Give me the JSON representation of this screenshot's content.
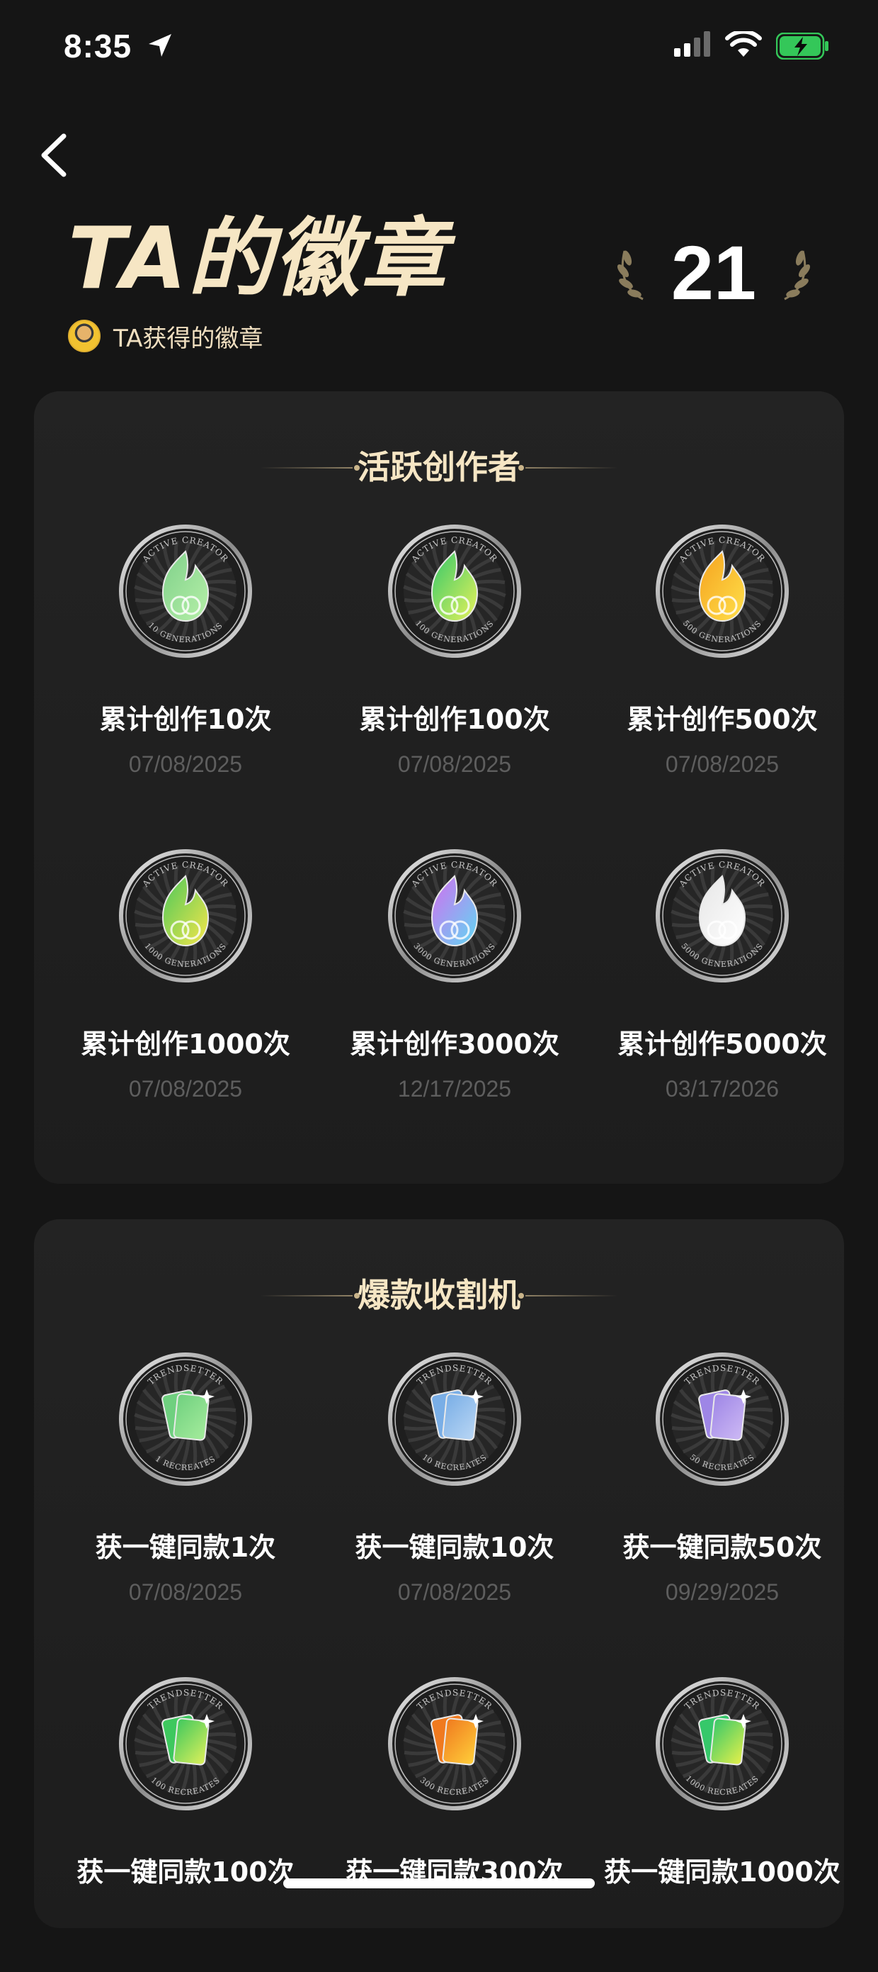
{
  "status_bar": {
    "time": "8:35"
  },
  "header": {
    "title": "TA的徽章",
    "subtitle": "TA获得的徽章",
    "badge_count": "21"
  },
  "sections": [
    {
      "title": "活跃创作者",
      "badges": [
        {
          "name": "累计创作10次",
          "date": "07/08/2025",
          "ring_top": "ACTIVE CREATOR",
          "ring_bottom": "10 GENERATIONS",
          "number": "10",
          "colors": [
            "#7fd08a",
            "#b6f0a8"
          ]
        },
        {
          "name": "累计创作100次",
          "date": "07/08/2025",
          "ring_top": "ACTIVE CREATOR",
          "ring_bottom": "100 GENERATIONS",
          "number": "100",
          "colors": [
            "#35c86a",
            "#e7f25a"
          ]
        },
        {
          "name": "累计创作500次",
          "date": "07/08/2025",
          "ring_top": "ACTIVE CREATOR",
          "ring_bottom": "500 GENERATIONS",
          "number": "500",
          "colors": [
            "#f5a21f",
            "#ffe04a"
          ]
        },
        {
          "name": "累计创作1000次",
          "date": "07/08/2025",
          "ring_top": "ACTIVE CREATOR",
          "ring_bottom": "1000 GENERATIONS",
          "number": "1000",
          "colors": [
            "#4cc85a",
            "#f6e64a"
          ]
        },
        {
          "name": "累计创作3000次",
          "date": "12/17/2025",
          "ring_top": "ACTIVE CREATOR",
          "ring_bottom": "3000 GENERATIONS",
          "number": "3000",
          "colors": [
            "#d36ef0",
            "#5fd8f2"
          ]
        },
        {
          "name": "累计创作5000次",
          "date": "03/17/2026",
          "ring_top": "ACTIVE CREATOR",
          "ring_bottom": "5000 GENERATIONS",
          "number": "5000",
          "colors": [
            "#e6e6e6",
            "#ffffff"
          ]
        }
      ]
    },
    {
      "title": "爆款收割机",
      "badges": [
        {
          "name": "获一键同款1次",
          "date": "07/08/2025",
          "ring_top": "TRENDSETTER",
          "ring_bottom": "1 RECREATES",
          "number": "1",
          "colors": [
            "#6fd07f",
            "#a5ec9c"
          ]
        },
        {
          "name": "获一键同款10次",
          "date": "07/08/2025",
          "ring_top": "TRENDSETTER",
          "ring_bottom": "10 RECREATES",
          "number": "10",
          "colors": [
            "#79aee6",
            "#b9d6f4"
          ]
        },
        {
          "name": "获一键同款50次",
          "date": "09/29/2025",
          "ring_top": "TRENDSETTER",
          "ring_bottom": "50 RECREATES",
          "number": "50",
          "colors": [
            "#9e86e6",
            "#cdb9f4"
          ]
        },
        {
          "name": "获一键同款100次",
          "date": "",
          "ring_top": "TRENDSETTER",
          "ring_bottom": "100 RECREATES",
          "number": "100",
          "colors": [
            "#3ec85e",
            "#dff05a"
          ]
        },
        {
          "name": "获一键同款300次",
          "date": "",
          "ring_top": "TRENDSETTER",
          "ring_bottom": "300 RECREATES",
          "number": "300",
          "colors": [
            "#f07a1f",
            "#ffcf3a"
          ]
        },
        {
          "name": "获一键同款1000次",
          "date": "",
          "ring_top": "TRENDSETTER",
          "ring_bottom": "1000 RECREATES",
          "number": "1000",
          "colors": [
            "#36c86a",
            "#e6f04a"
          ]
        }
      ]
    }
  ],
  "icons": {
    "back": "chevron-left-icon",
    "location": "location-arrow-icon",
    "signal": "cellular-signal-icon",
    "wifi": "wifi-icon",
    "battery": "battery-charging-icon",
    "laurel": "laurel-icon"
  },
  "colors": {
    "accent": "#f6e6c4",
    "battery": "#34c759",
    "background": "#151515"
  }
}
